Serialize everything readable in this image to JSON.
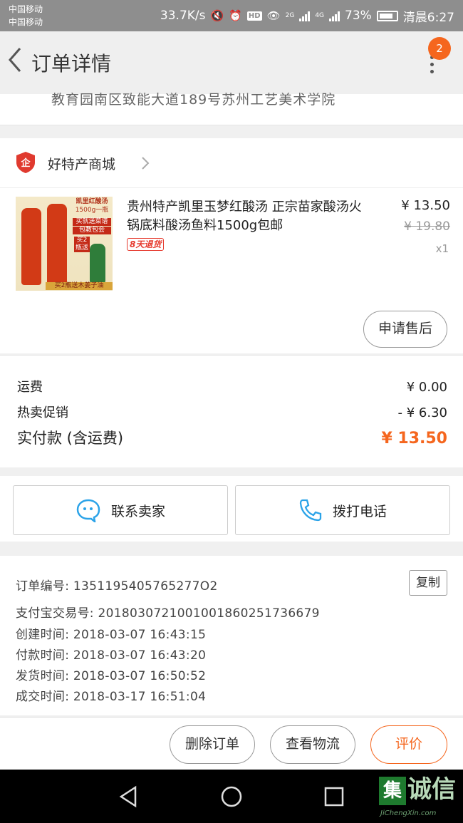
{
  "status_bar": {
    "carrier1": "中国移动",
    "carrier2": "中国移动",
    "speed": "33.7K/s",
    "hd": "HD",
    "net1": "2G",
    "net2": "4G",
    "battery_pct": "73%",
    "time": "清晨6:27"
  },
  "nav": {
    "title": "订单详情",
    "badge_count": "2"
  },
  "address": {
    "text": "教育园南区致能大道189号苏州工艺美术学院"
  },
  "shop": {
    "name": "好特产商城",
    "icon_letter": "企"
  },
  "product": {
    "title": "贵州特产凯里玉梦红酸汤 正宗苗家酸汤火锅底料酸汤鱼料1500g包邮",
    "return_badge": "8天退货",
    "price": "¥ 13.50",
    "original_price": "¥ 19.80",
    "quantity": "x1",
    "image_labels": [
      "凯里红酸汤",
      "1500g一瓶",
      "买就送菜谱",
      "包教包会",
      "买2瓶送",
      "买2瓶送木姜子油"
    ]
  },
  "after_sale_label": "申请售后",
  "costs": {
    "shipping_label": "运费",
    "shipping_value": "¥ 0.00",
    "promo_label": "热卖促销",
    "promo_value": "- ¥ 6.30",
    "paid_label": "实付款 (含运费)",
    "paid_value": "¥ 13.50"
  },
  "contact": {
    "seller_label": "联系卖家",
    "phone_label": "拨打电话"
  },
  "order_info": {
    "order_no": "订单编号: 1351195405765277O2",
    "alipay_no": "支付宝交易号: 2018030721001001860251736679",
    "created": "创建时间: 2018-03-07 16:43:15",
    "paid": "付款时间: 2018-03-07 16:43:20",
    "shipped": "发货时间: 2018-03-07 16:50:52",
    "completed": "成交时间: 2018-03-17 16:51:04",
    "copy_label": "复制"
  },
  "actions": {
    "delete_label": "删除订单",
    "logistics_label": "查看物流",
    "review_label": "评价"
  },
  "watermark": {
    "logo_char": "集",
    "text": "诚信",
    "sub": "JiChengXin.com"
  },
  "colors": {
    "accent": "#f5661e",
    "status_bar": "#8e8e8e",
    "shop_icon_red": "#e03a2f"
  }
}
